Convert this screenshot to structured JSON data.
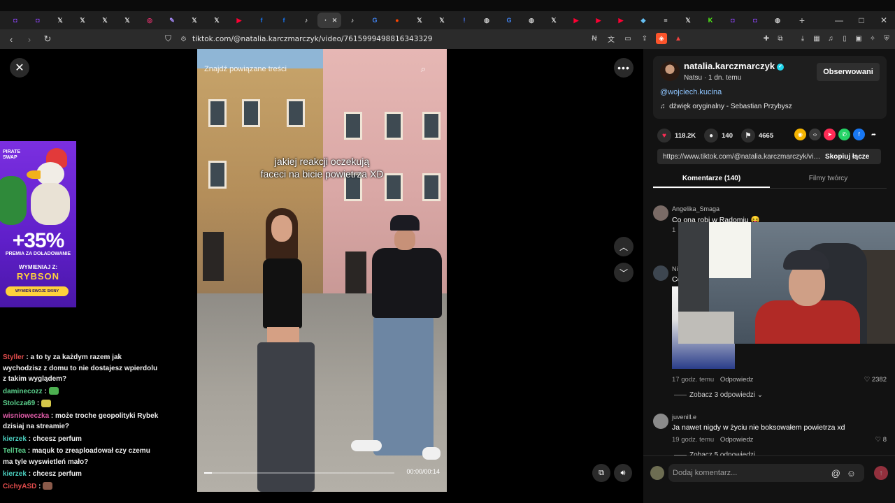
{
  "browser": {
    "tabs": [
      {
        "icon": "twitch-icon",
        "glyph": "◘",
        "color": "#9146ff"
      },
      {
        "icon": "twitch-icon",
        "glyph": "◘",
        "color": "#9146ff"
      },
      {
        "icon": "x-icon",
        "glyph": "𝕏",
        "color": "#ddd"
      },
      {
        "icon": "x-icon",
        "glyph": "𝕏",
        "color": "#ddd"
      },
      {
        "icon": "x-icon",
        "glyph": "𝕏",
        "color": "#ddd"
      },
      {
        "icon": "x-icon",
        "glyph": "𝕏",
        "color": "#ddd"
      },
      {
        "icon": "instagram-icon",
        "glyph": "◎",
        "color": "#e1306c"
      },
      {
        "icon": "feather-icon",
        "glyph": "✎",
        "color": "#a78bfa"
      },
      {
        "icon": "x-icon",
        "glyph": "𝕏",
        "color": "#ddd"
      },
      {
        "icon": "x-icon",
        "glyph": "𝕏",
        "color": "#ddd"
      },
      {
        "icon": "youtube-icon",
        "glyph": "▶",
        "color": "#ff0033"
      },
      {
        "icon": "facebook-icon",
        "glyph": "f",
        "color": "#1877f2"
      },
      {
        "icon": "facebook-icon",
        "glyph": "f",
        "color": "#1877f2"
      },
      {
        "icon": "tiktok-icon",
        "glyph": "♪",
        "color": "#fff"
      },
      {
        "icon": "tiktok-icon",
        "glyph": "·",
        "color": "#fff",
        "active": true
      },
      {
        "icon": "tiktok-icon",
        "glyph": "♪",
        "color": "#fff"
      },
      {
        "icon": "google-icon",
        "glyph": "G",
        "color": "#4285f4"
      },
      {
        "icon": "reddit-icon",
        "glyph": "●",
        "color": "#ff4500"
      },
      {
        "icon": "x-icon",
        "glyph": "𝕏",
        "color": "#ddd"
      },
      {
        "icon": "x-icon",
        "glyph": "𝕏",
        "color": "#ddd"
      },
      {
        "icon": "alert-icon",
        "glyph": "!",
        "color": "#4b7bff"
      },
      {
        "icon": "globe-icon",
        "glyph": "◍",
        "color": "#ccc"
      },
      {
        "icon": "google-icon",
        "glyph": "G",
        "color": "#4285f4"
      },
      {
        "icon": "globe-icon",
        "glyph": "◍",
        "color": "#ccc"
      },
      {
        "icon": "x-icon",
        "glyph": "𝕏",
        "color": "#ddd"
      },
      {
        "icon": "youtube-icon",
        "glyph": "▶",
        "color": "#ff0033"
      },
      {
        "icon": "youtube-icon",
        "glyph": "▶",
        "color": "#ff0033"
      },
      {
        "icon": "youtube-icon",
        "glyph": "▶",
        "color": "#ff0033"
      },
      {
        "icon": "steam-icon",
        "glyph": "◆",
        "color": "#66c0f4"
      },
      {
        "icon": "database-icon",
        "glyph": "≡",
        "color": "#ddd"
      },
      {
        "icon": "x-icon",
        "glyph": "𝕏",
        "color": "#ddd"
      },
      {
        "icon": "kick-icon",
        "glyph": "K",
        "color": "#53fc18"
      },
      {
        "icon": "twitch-icon",
        "glyph": "◘",
        "color": "#9146ff"
      },
      {
        "icon": "twitch-icon",
        "glyph": "◘",
        "color": "#9146ff"
      },
      {
        "icon": "globe-icon",
        "glyph": "◍",
        "color": "#ccc"
      }
    ],
    "new_tab": "+",
    "window_controls": [
      "—",
      "□",
      "✕"
    ],
    "url": "tiktok.com/@natalia.karczmarczyk/video/7615999498816343329"
  },
  "video": {
    "search_placeholder": "Znajdź powiązane treści",
    "caption_line1": "jakiej reakcji oczekują",
    "caption_line2": "faceci na bicie powietrza XD",
    "timecode": "00:00/00:14",
    "progress": 0.04
  },
  "ad": {
    "brand_line1": "PIRATE",
    "brand_line2": "SWAP",
    "bonus": "+35%",
    "bonus_sub": "PREMIA ZA DOŁADOWANIE",
    "code_label": "WYMIENIAJ Z:",
    "code": "RYBSON",
    "cta": "WYMIEŃ SWOJE SKINY"
  },
  "chat": [
    {
      "user": "Styller",
      "text": ": a to ty za każdym razem jak wychodzisz z domu to nie dostajesz wpierdolu z takim wyglądem?",
      "color": "red"
    },
    {
      "user": "daminecozz",
      "text": ":",
      "color": "green",
      "emote": "#4caf50"
    },
    {
      "user": "Stolcza69",
      "text": ":",
      "color": "green",
      "emote": "#d6c84a"
    },
    {
      "user": "wisnioweczka",
      "text": ": może troche geopolityki Rybek dzisiaj na streamie?",
      "color": "pink"
    },
    {
      "user": "kierzek",
      "text": ": chcesz perfum",
      "color": "teal"
    },
    {
      "user": "TellTea",
      "text": ": maquk to zreaploadował czy czemu ma tyle wyswietleń mało?",
      "color": "green"
    },
    {
      "user": "kierzek",
      "text": ": chcesz perfum",
      "color": "teal"
    },
    {
      "user": "CichyASD",
      "text": ":",
      "color": "red",
      "emote": "#8a5a4a"
    }
  ],
  "creator": {
    "name": "natalia.karczmarczyk",
    "meta": "Natsu · 1 dn. temu",
    "follow_label": "Obserwowani",
    "mention": "@wojciech.kucina",
    "sound": "dźwięk oryginalny - Sebastian Przybysz"
  },
  "stats": {
    "likes": "118.2K",
    "comments": "140",
    "saves": "4665"
  },
  "share_icons": [
    {
      "name": "coin-icon",
      "glyph": "◉",
      "color": "#f5b400"
    },
    {
      "name": "embed-icon",
      "glyph": "‹›",
      "color": "#3a3a3a"
    },
    {
      "name": "send-icon",
      "glyph": "➤",
      "color": "#fe2c55"
    },
    {
      "name": "whatsapp-icon",
      "glyph": "✆",
      "color": "#25d366"
    },
    {
      "name": "facebook-icon",
      "glyph": "f",
      "color": "#1877f2"
    },
    {
      "name": "share-arrow-icon",
      "glyph": "➦",
      "color": "#121212"
    }
  ],
  "copy": {
    "link": "https://www.tiktok.com/@natalia.karczmarczyk/vid...",
    "button": "Skopiuj łącze"
  },
  "tabs": {
    "comments": "Komentarze (140)",
    "creator_videos": "Filmy twórcy"
  },
  "comments": [
    {
      "user": "Angelika_Smaga",
      "text": "Co ona robi w Radomiu 😝",
      "time": "1",
      "reply": "",
      "likes": ""
    },
    {
      "user": "Ni",
      "text": "Co",
      "time": "17 godz. temu",
      "reply": "Odpowiedz",
      "likes": "2382",
      "more": "Zobacz 3 odpowiedzi ⌄"
    },
    {
      "user": "juvenill.e",
      "text": "Ja nawet nigdy w życiu nie boksowałem powietrza xd",
      "time": "19 godz. temu",
      "reply": "Odpowiedz",
      "likes": "8",
      "more": "Zobacz 5 odpowiedzi"
    }
  ],
  "compose": {
    "placeholder": "Dodaj komentarz...",
    "at": "@",
    "emoji": "☺"
  }
}
